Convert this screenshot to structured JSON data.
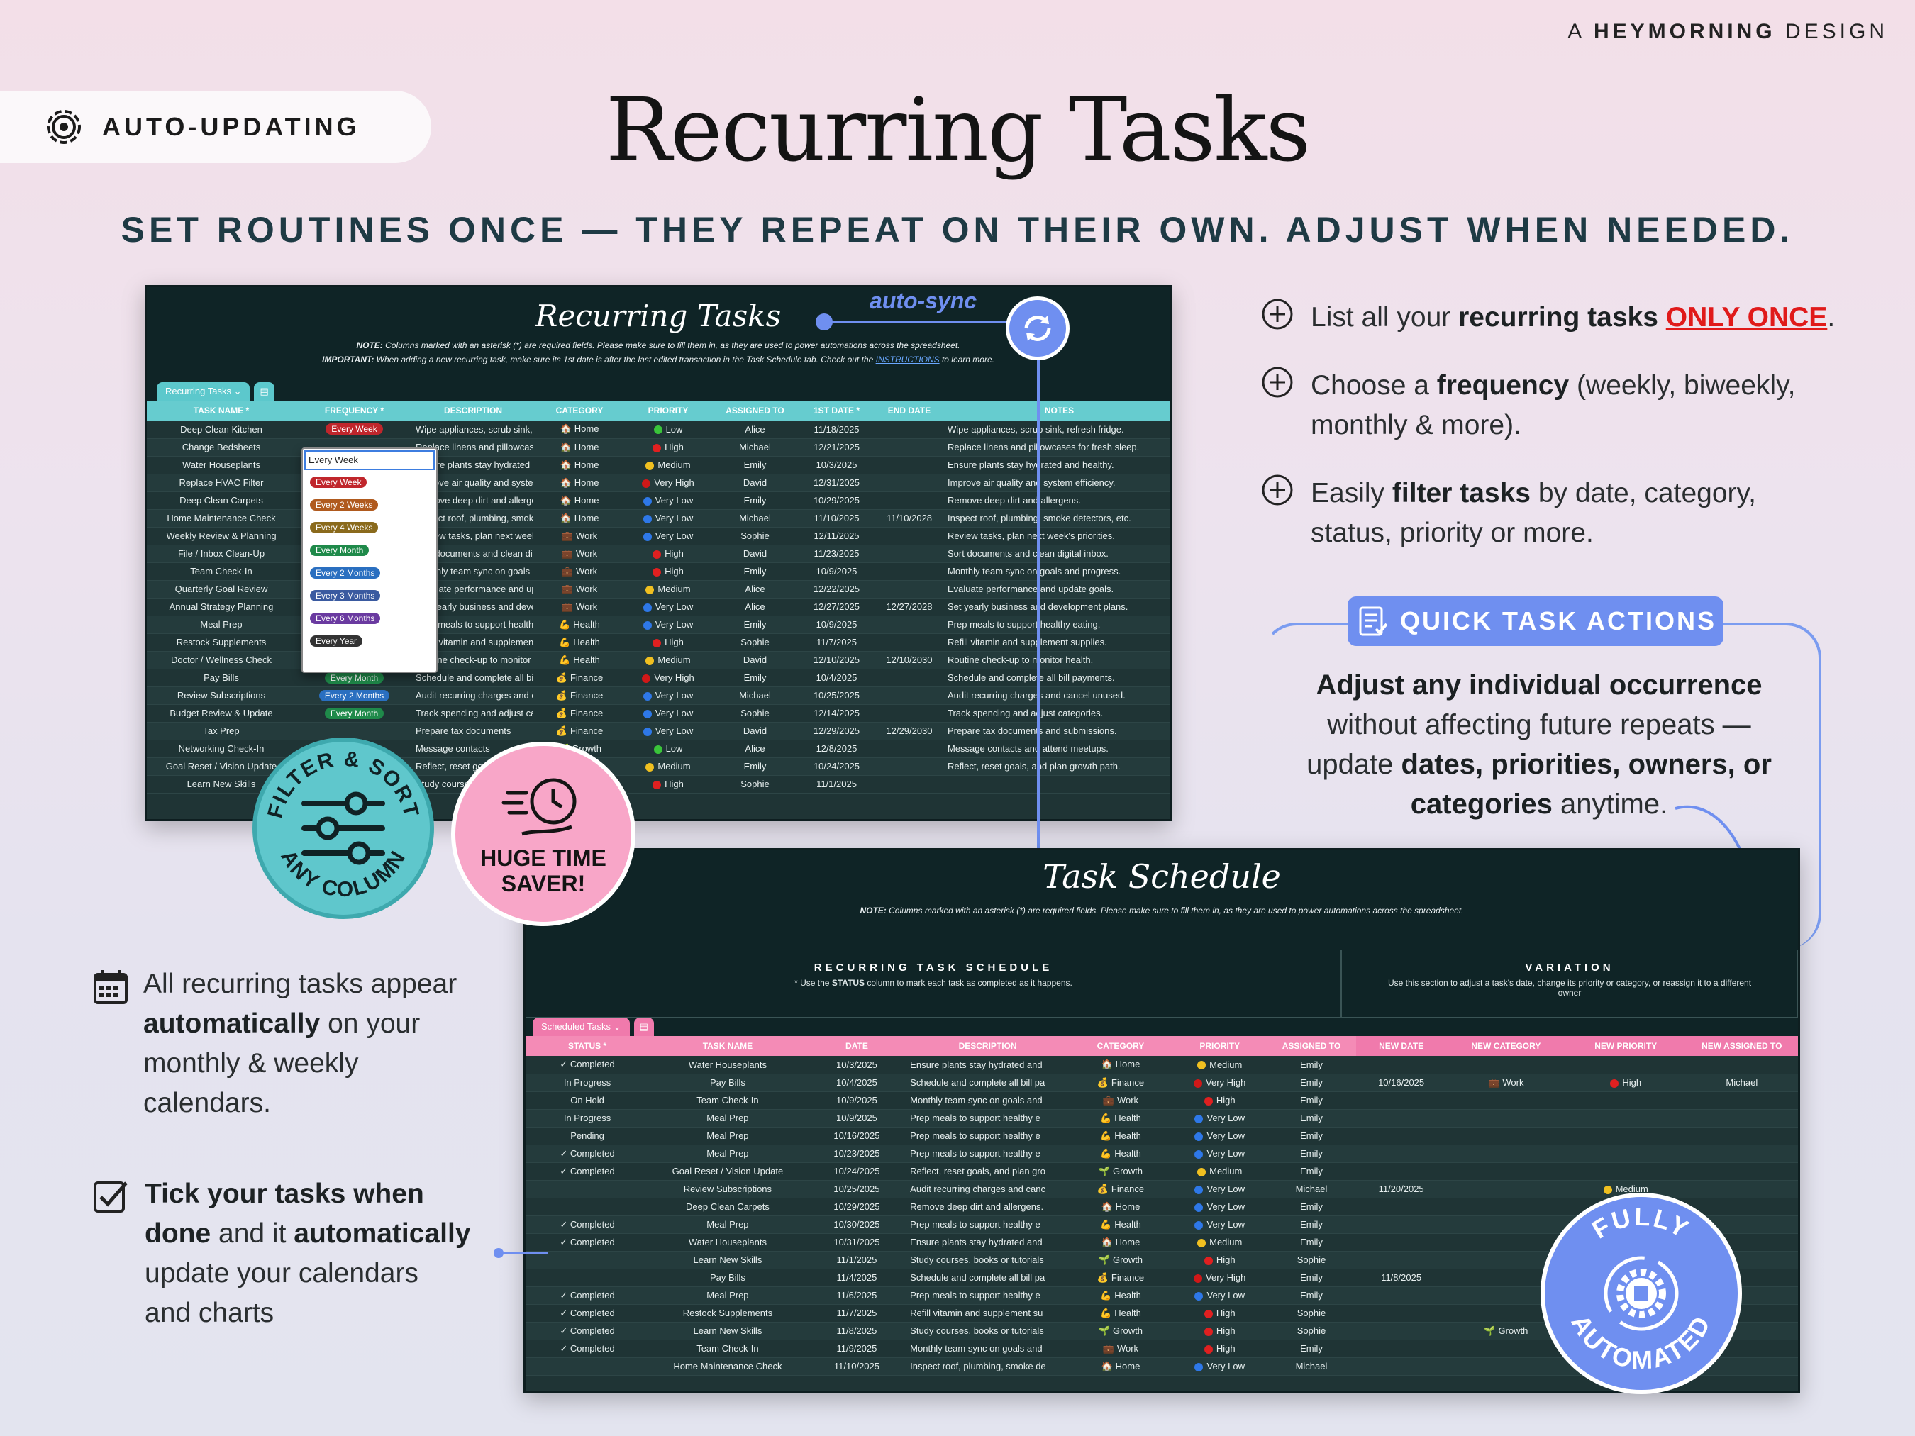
{
  "brand": {
    "prefix": "A",
    "name": "HEYMORNING",
    "suffix": "DESIGN"
  },
  "pill": {
    "label": "AUTO-UPDATING",
    "icon": "gear-refresh-icon"
  },
  "title": "Recurring Tasks",
  "subtitle": "SET ROUTINES ONCE — THEY REPEAT ON THEIR OWN. ADJUST WHEN NEEDED.",
  "autosync": "auto-sync",
  "features": [
    {
      "pre": "List all your ",
      "bold": "recurring tasks",
      "mid": " ",
      "red": "ONLY ONCE",
      "post": "."
    },
    {
      "pre": "Choose a ",
      "bold": "frequency",
      "post": " (weekly, biweekly,",
      "line2": "monthly & more)."
    },
    {
      "pre": "Easily ",
      "bold": "filter tasks",
      "post": " by date, category,",
      "line2": "status, priority or more."
    }
  ],
  "qta": {
    "badge": "QUICK TASK ACTIONS",
    "b1": "Adjust any individual occurrence",
    "t1": "without affecting future repeats —",
    "t2": "update ",
    "b2": "dates, priorities, owners, or",
    "b3": "categories",
    "t3": " anytime."
  },
  "left_features": [
    {
      "l1": "All recurring tasks appear",
      "b": "automatically",
      "l2": " on your",
      "l3": "monthly & weekly",
      "l4": "calendars."
    },
    {
      "b1": "Tick your tasks when",
      "b2": "done",
      "t1": " and it ",
      "b3": "automatically",
      "l3": "update your calendars",
      "l4": "and charts"
    }
  ],
  "badges": {
    "filter": {
      "top": "FILTER & SORT",
      "bottom": "ANY COLUMN"
    },
    "time": {
      "l1": "HUGE TIME",
      "l2": "SAVER!"
    },
    "auto": {
      "top": "FULLY",
      "bottom": "AUTOMATED"
    }
  },
  "sheet1": {
    "title": "Recurring Tasks",
    "note1_b": "NOTE:",
    "note1": " Columns marked with an asterisk (*) are required fields. Please make sure to fill them in, as they are used to power automations across the spreadsheet.",
    "note2_b": "IMPORTANT:",
    "note2": " When adding a new recurring task, make sure its 1st date is after the last edited transaction in the Task Schedule tab. Check out the ",
    "note2_link": "INSTRUCTIONS",
    "note2_end": " to learn more.",
    "tab": "Recurring Tasks",
    "headers": [
      "TASK NAME *",
      "FREQUENCY *",
      "DESCRIPTION",
      "CATEGORY",
      "PRIORITY",
      "ASSIGNED TO",
      "1ST DATE *",
      "END DATE",
      "NOTES"
    ],
    "rows": [
      [
        "Deep Clean Kitchen",
        "Every Week",
        "Wipe appliances, scrub sink, refr",
        "Home",
        "Low",
        "Alice",
        "11/18/2025",
        "",
        "Wipe appliances, scrub sink, refresh fridge."
      ],
      [
        "Change Bedsheets",
        "",
        "Replace linens and pillowcases f",
        "Home",
        "High",
        "Michael",
        "12/21/2025",
        "",
        "Replace linens and pillowcases for fresh sleep."
      ],
      [
        "Water Houseplants",
        "",
        "Ensure plants stay hydrated and",
        "Home",
        "Medium",
        "Emily",
        "10/3/2025",
        "",
        "Ensure plants stay hydrated and healthy."
      ],
      [
        "Replace HVAC Filter",
        "",
        "Improve air quality and system e",
        "Home",
        "Very High",
        "David",
        "12/31/2025",
        "",
        "Improve air quality and system efficiency."
      ],
      [
        "Deep Clean Carpets",
        "",
        "Remove deep dirt and allergens.",
        "Home",
        "Very Low",
        "Emily",
        "10/29/2025",
        "",
        "Remove deep dirt and allergens."
      ],
      [
        "Home Maintenance Check",
        "",
        "Inspect roof, plumbing, smoke de",
        "Home",
        "Very Low",
        "Michael",
        "11/10/2025",
        "11/10/2028",
        "Inspect roof, plumbing, smoke detectors, etc."
      ],
      [
        "Weekly Review & Planning",
        "",
        "Review tasks, plan next week's p",
        "Work",
        "Very Low",
        "Sophie",
        "12/11/2025",
        "",
        "Review tasks, plan next week's priorities."
      ],
      [
        "File / Inbox Clean-Up",
        "",
        "Sort documents and clean digita",
        "Work",
        "High",
        "David",
        "11/23/2025",
        "",
        "Sort documents and clean digital inbox."
      ],
      [
        "Team Check-In",
        "",
        "Monthly team sync on goals and",
        "Work",
        "High",
        "Emily",
        "10/9/2025",
        "",
        "Monthly team sync on goals and progress."
      ],
      [
        "Quarterly Goal Review",
        "",
        "Evaluate performance and updat",
        "Work",
        "Medium",
        "Alice",
        "12/22/2025",
        "",
        "Evaluate performance and update goals."
      ],
      [
        "Annual Strategy Planning",
        "",
        "Set yearly business and develop",
        "Work",
        "Very Low",
        "Alice",
        "12/27/2025",
        "12/27/2028",
        "Set yearly business and development plans."
      ],
      [
        "Meal Prep",
        "",
        "Prep meals to support healthy ea",
        "Health",
        "Very Low",
        "Emily",
        "10/9/2025",
        "",
        "Prep meals to support healthy eating."
      ],
      [
        "Restock Supplements",
        "",
        "Refill vitamin and supplement su",
        "Health",
        "High",
        "Sophie",
        "11/7/2025",
        "",
        "Refill vitamin and supplement supplies."
      ],
      [
        "Doctor / Wellness Check",
        "",
        "Routine check-up to monitor hea",
        "Health",
        "Medium",
        "David",
        "12/10/2025",
        "12/10/2030",
        "Routine check-up to monitor health."
      ],
      [
        "Pay Bills",
        "Every Month",
        "Schedule and complete all bill pa",
        "Finance",
        "Very High",
        "Emily",
        "10/4/2025",
        "",
        "Schedule and complete all bill payments."
      ],
      [
        "Review Subscriptions",
        "Every 2 Months",
        "Audit recurring charges and canc",
        "Finance",
        "Very Low",
        "Michael",
        "10/25/2025",
        "",
        "Audit recurring charges and cancel unused."
      ],
      [
        "Budget Review & Update",
        "Every Month",
        "Track spending and adjust categ",
        "Finance",
        "Very Low",
        "Sophie",
        "12/14/2025",
        "",
        "Track spending and adjust categories."
      ],
      [
        "Tax Prep",
        "",
        "Prepare tax documents",
        "Finance",
        "Very Low",
        "David",
        "12/29/2025",
        "12/29/2030",
        "Prepare tax documents and submissions."
      ],
      [
        "Networking Check-In",
        "",
        "Message contacts",
        "Growth",
        "Low",
        "Alice",
        "12/8/2025",
        "",
        "Message contacts and attend meetups."
      ],
      [
        "Goal Reset / Vision Update",
        "",
        "Reflect, reset goals",
        "Growth",
        "Medium",
        "Emily",
        "10/24/2025",
        "",
        "Reflect, reset goals, and plan growth path."
      ],
      [
        "Learn New Skills",
        "",
        "Study courses",
        "Growth",
        "High",
        "Sophie",
        "11/1/2025",
        "",
        ""
      ]
    ],
    "dropdown": {
      "input": "Every Week",
      "options": [
        "Every Week",
        "Every 2 Weeks",
        "Every 4 Weeks",
        "Every Month",
        "Every 2 Months",
        "Every 3 Months",
        "Every 6 Months",
        "Every Year"
      ]
    }
  },
  "sheet2": {
    "title": "Task Schedule",
    "note_b": "NOTE:",
    "note": " Columns marked with an asterisk (*) are required fields. Please make sure to fill them in, as they are used to power automations across the spreadsheet.",
    "sec1": "RECURRING TASK SCHEDULE",
    "sec1_sub_pre": "* Use the ",
    "sec1_sub_b": "STATUS",
    "sec1_sub_post": " column to mark each task as completed as it happens.",
    "sec2": "VARIATION",
    "sec2_sub": "Use this section to adjust a task's date, change its priority or category, or reassign it to a different owner",
    "tab": "Scheduled Tasks",
    "headers": [
      "STATUS *",
      "TASK NAME",
      "DATE",
      "DESCRIPTION",
      "CATEGORY",
      "PRIORITY",
      "ASSIGNED TO",
      "NEW DATE",
      "NEW CATEGORY",
      "NEW PRIORITY",
      "NEW ASSIGNED TO"
    ],
    "rows": [
      [
        "✓ Completed",
        "Water Houseplants",
        "10/3/2025",
        "Ensure plants stay hydrated and",
        "Home",
        "Medium",
        "Emily",
        "",
        "",
        "",
        ""
      ],
      [
        "In Progress",
        "Pay Bills",
        "10/4/2025",
        "Schedule and complete all bill pa",
        "Finance",
        "Very High",
        "Emily",
        "10/16/2025",
        "Work",
        "High",
        "Michael"
      ],
      [
        "On Hold",
        "Team Check-In",
        "10/9/2025",
        "Monthly team sync on goals and",
        "Work",
        "High",
        "Emily",
        "",
        "",
        "",
        ""
      ],
      [
        "In Progress",
        "Meal Prep",
        "10/9/2025",
        "Prep meals to support healthy e",
        "Health",
        "Very Low",
        "Emily",
        "",
        "",
        "",
        ""
      ],
      [
        "Pending",
        "Meal Prep",
        "10/16/2025",
        "Prep meals to support healthy e",
        "Health",
        "Very Low",
        "Emily",
        "",
        "",
        "",
        ""
      ],
      [
        "✓ Completed",
        "Meal Prep",
        "10/23/2025",
        "Prep meals to support healthy e",
        "Health",
        "Very Low",
        "Emily",
        "",
        "",
        "",
        ""
      ],
      [
        "✓ Completed",
        "Goal Reset / Vision Update",
        "10/24/2025",
        "Reflect, reset goals, and plan gro",
        "Growth",
        "Medium",
        "Emily",
        "",
        "",
        "",
        ""
      ],
      [
        "",
        "Review Subscriptions",
        "10/25/2025",
        "Audit recurring charges and canc",
        "Finance",
        "Very Low",
        "Michael",
        "11/20/2025",
        "",
        "Medium",
        ""
      ],
      [
        "",
        "Deep Clean Carpets",
        "10/29/2025",
        "Remove deep dirt and allergens.",
        "Home",
        "Very Low",
        "Emily",
        "",
        "",
        "",
        ""
      ],
      [
        "✓ Completed",
        "Meal Prep",
        "10/30/2025",
        "Prep meals to support healthy e",
        "Health",
        "Very Low",
        "Emily",
        "",
        "",
        "",
        ""
      ],
      [
        "✓ Completed",
        "Water Houseplants",
        "10/31/2025",
        "Ensure plants stay hydrated and",
        "Home",
        "Medium",
        "Emily",
        "",
        "",
        "",
        ""
      ],
      [
        "",
        "Learn New Skills",
        "11/1/2025",
        "Study courses, books or tutorials",
        "Growth",
        "High",
        "Sophie",
        "",
        "",
        "",
        ""
      ],
      [
        "",
        "Pay Bills",
        "11/4/2025",
        "Schedule and complete all bill pa",
        "Finance",
        "Very High",
        "Emily",
        "11/8/2025",
        "",
        "",
        ""
      ],
      [
        "✓ Completed",
        "Meal Prep",
        "11/6/2025",
        "Prep meals to support healthy e",
        "Health",
        "Very Low",
        "Emily",
        "",
        "",
        "",
        ""
      ],
      [
        "✓ Completed",
        "Restock Supplements",
        "11/7/2025",
        "Refill vitamin and supplement su",
        "Health",
        "High",
        "Sophie",
        "",
        "",
        "",
        ""
      ],
      [
        "✓ Completed",
        "Learn New Skills",
        "11/8/2025",
        "Study courses, books or tutorials",
        "Growth",
        "High",
        "Sophie",
        "",
        "Growth",
        "",
        ""
      ],
      [
        "✓ Completed",
        "Team Check-In",
        "11/9/2025",
        "Monthly team sync on goals and",
        "Work",
        "High",
        "Emily",
        "",
        "",
        "",
        ""
      ],
      [
        "",
        "Home Maintenance Check",
        "11/10/2025",
        "Inspect roof, plumbing, smoke de",
        "Home",
        "Very Low",
        "Michael",
        "",
        "",
        "",
        ""
      ]
    ]
  },
  "colors": {
    "teal": "#5fc7cc",
    "pink": "#f48bb6",
    "blue": "#6f8ff0",
    "sheet": "#1f3435",
    "low": "#3ac43a",
    "high": "#e02020",
    "medium": "#f0c020",
    "verylow": "#2e78e8",
    "veryhigh": "#d01818"
  }
}
